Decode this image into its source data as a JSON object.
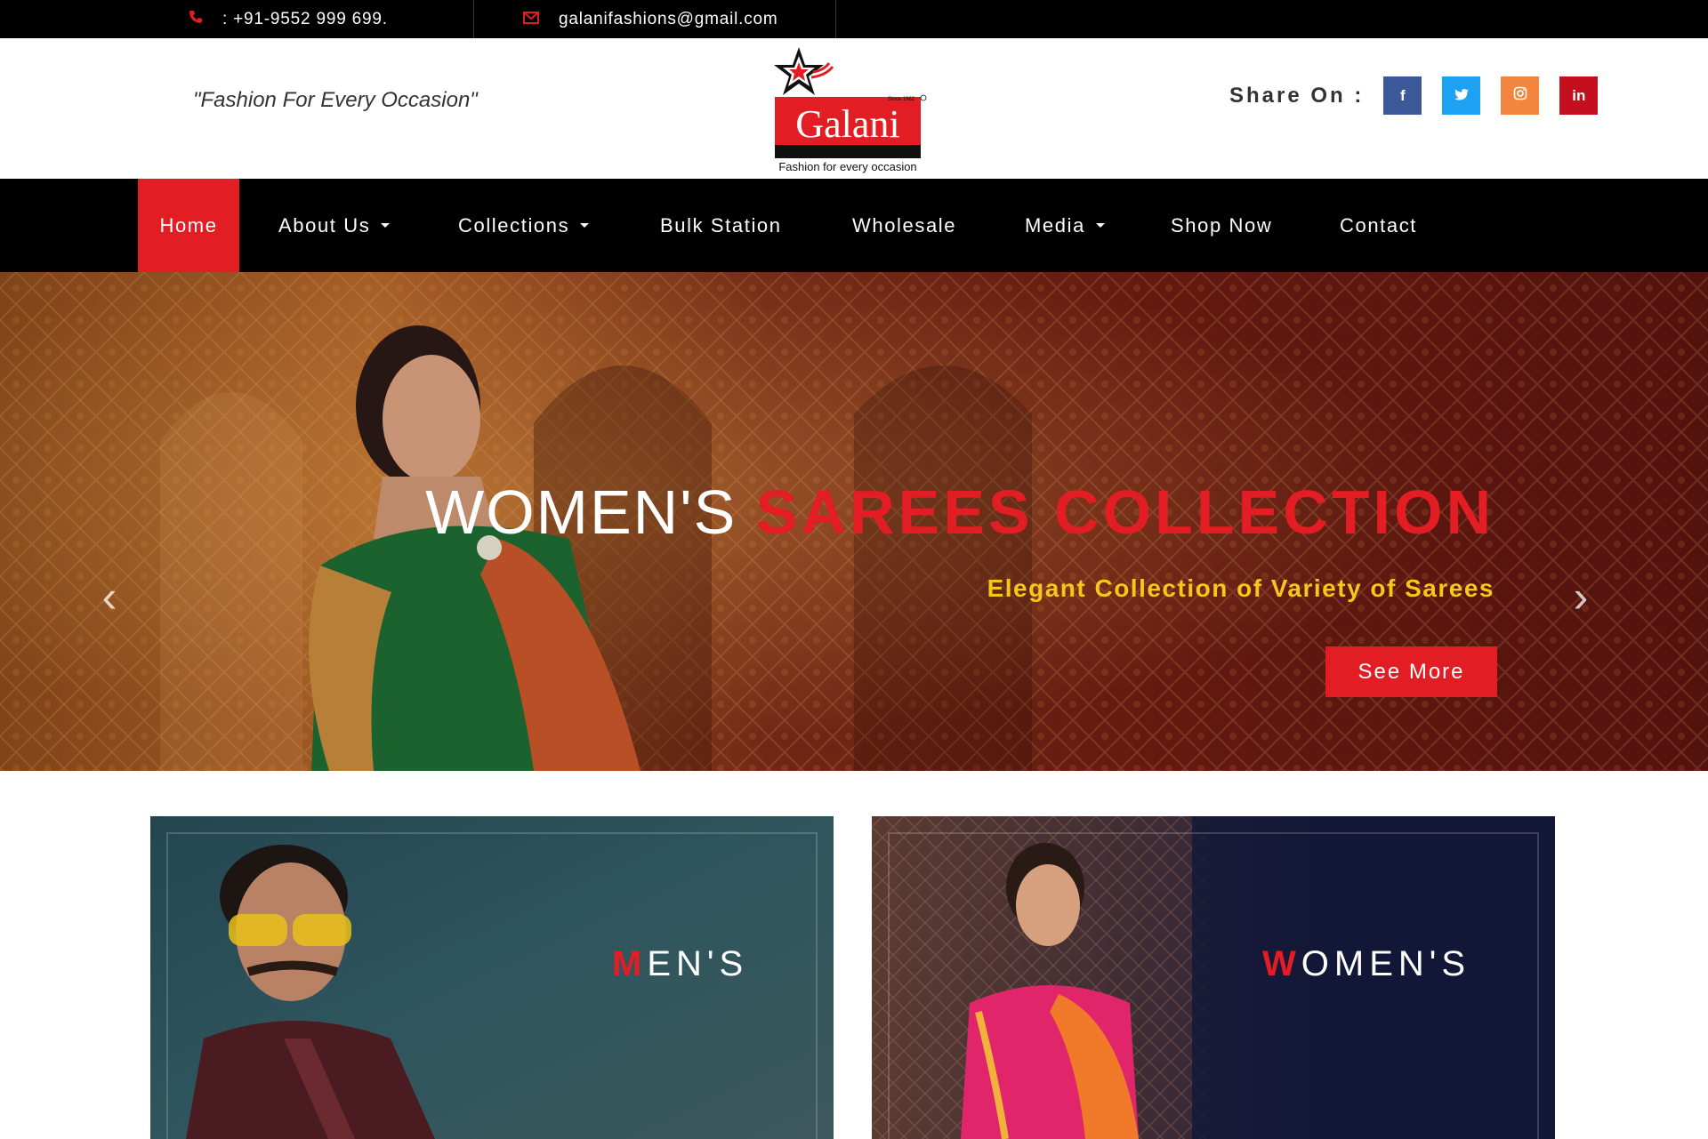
{
  "topbar": {
    "phone": ": +91-9552 999 699.",
    "email": "galanifashions@gmail.com"
  },
  "header": {
    "tagline": "\"Fashion For Every Occasion\"",
    "logo": {
      "brand": "Galani",
      "since": "Since 1962",
      "slogan": "Fashion for every occasion"
    },
    "share_label": "Share On :",
    "social": [
      {
        "name": "facebook-icon",
        "glyph": "f"
      },
      {
        "name": "twitter-icon",
        "glyph": "t"
      },
      {
        "name": "instagram-icon",
        "glyph": "◎"
      },
      {
        "name": "linkedin-icon",
        "glyph": "in"
      }
    ]
  },
  "nav": {
    "items": [
      {
        "label": "Home",
        "active": true
      },
      {
        "label": "About Us",
        "dropdown": true
      },
      {
        "label": "Collections",
        "dropdown": true
      },
      {
        "label": "Bulk Station"
      },
      {
        "label": "Wholesale"
      },
      {
        "label": "Media",
        "dropdown": true
      },
      {
        "label": "Shop Now"
      },
      {
        "label": "Contact"
      }
    ]
  },
  "hero": {
    "title_white": "WOMEN'S",
    "title_red": "SAREES COLLECTION",
    "subtitle": "Elegant Collection of Variety of Sarees",
    "button": "See More",
    "prev_glyph": "‹",
    "next_glyph": "›"
  },
  "categories": {
    "men": {
      "first": "M",
      "rest": "EN'S"
    },
    "women": {
      "first": "W",
      "rest": "OMEN'S"
    }
  },
  "colors": {
    "accent_red": "#e21d23",
    "topbar_bg": "#000000",
    "subtitle_yellow": "#f7c61b"
  }
}
